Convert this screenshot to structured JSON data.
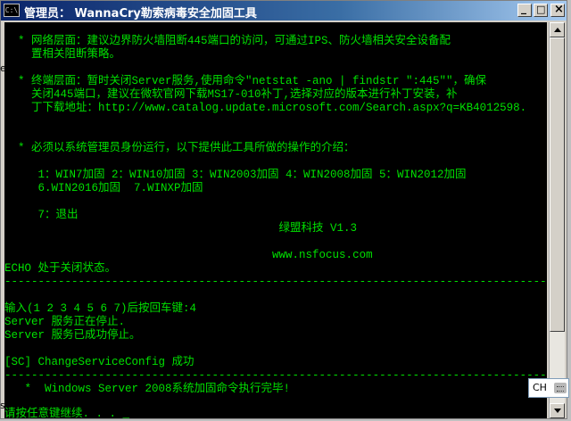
{
  "window": {
    "icon_label": "C:\\",
    "title": "管理员： WannaCry勒索病毒安全加固工具",
    "min_glyph": "_",
    "max_glyph": "□",
    "close_glyph": "×"
  },
  "console": {
    "lines": [
      "  * 网络层面：建议边界防火墙阻断445端口的访问，可通过IPS、防火墙相关安全设备配",
      "    置相关阻断策略。",
      "",
      "  * 终端层面：暂时关闭Server服务,使用命令\"netstat -ano | findstr \":445\"\"，确保",
      "    关闭445端口，建议在微软官网下载MS17-010补丁,选择对应的版本进行补丁安装，补",
      "    丁下载地址：http://www.catalog.update.microsoft.com/Search.aspx?q=KB4012598.",
      "",
      "",
      "  * 必须以系统管理员身份运行，以下提供此工具所做的操作的介绍：",
      "",
      "     1：WIN7加固 2：WIN10加固 3：WIN2003加固 4：WIN2008加固 5：WIN2012加固",
      "     6.WIN2016加固  7.WINXP加固",
      "",
      "     7：退出",
      "                                         绿盟科技 V1.3",
      "",
      "                                        www.nsfocus.com",
      "ECHO 处于关闭状态。",
      "------------------------------------------------------------------------------------",
      "",
      "输入(1 2 3 4 5 6 7)后按回车键:4",
      "Server 服务正在停止.",
      "Server 服务已成功停止。",
      "",
      "[SC] ChangeServiceConfig 成功",
      "------------------------------------------------------------------------------------",
      "   *  Windows Server 2008系统加固命令执行完毕!",
      "",
      "请按任意键继续. . . _"
    ]
  },
  "langbar": {
    "label": "CH"
  },
  "desktop": {
    "mark1": "e",
    "mark2": "s"
  },
  "colors": {
    "console_text": "#00e000",
    "console_bg": "#000000",
    "titlebar_start": "#0a246a",
    "titlebar_end": "#a6caf0"
  }
}
